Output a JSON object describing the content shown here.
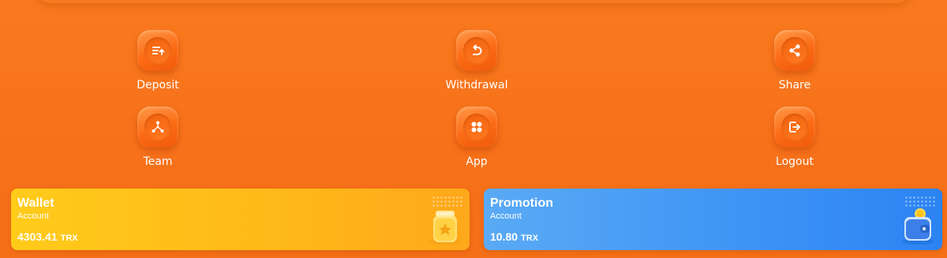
{
  "actions": {
    "deposit": {
      "label": "Deposit",
      "icon": "deposit-icon"
    },
    "withdrawal": {
      "label": "Withdrawal",
      "icon": "undo-arrow-icon"
    },
    "share": {
      "label": "Share",
      "icon": "share-icon"
    },
    "team": {
      "label": "Team",
      "icon": "team-network-icon"
    },
    "app": {
      "label": "App",
      "icon": "app-grid-icon"
    },
    "logout": {
      "label": "Logout",
      "icon": "logout-icon"
    }
  },
  "cards": {
    "wallet": {
      "title": "Wallet",
      "subtitle": "Account",
      "amount": "4303.41",
      "unit": "TRX",
      "icon": "wallet-jar-icon"
    },
    "promotion": {
      "title": "Promotion",
      "subtitle": "Account",
      "amount": "10.80",
      "unit": "TRX",
      "icon": "wallet-coin-icon"
    }
  },
  "colors": {
    "background": "#f7711a",
    "wallet_card": "#ffb81a",
    "promotion_card": "#3f95f5",
    "text": "#ffffff"
  }
}
